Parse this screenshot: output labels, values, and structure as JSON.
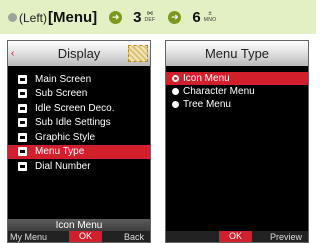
{
  "instruction": {
    "prefix": "(Left)",
    "menu": "[Menu]",
    "step1_number": "3",
    "step1_symbol": "⋈",
    "step1_letters": "DEF",
    "step2_number": "6",
    "step2_symbol": "±",
    "step2_letters": "MNO",
    "arrow_icon": "arrow-right-icon"
  },
  "left_screen": {
    "title": "Display",
    "items": [
      {
        "label": "Main Screen",
        "icon": "main-screen-icon"
      },
      {
        "label": "Sub Screen",
        "icon": "sub-screen-icon"
      },
      {
        "label": "Idle Screen Deco.",
        "icon": "idle-deco-icon"
      },
      {
        "label": "Sub Idle Settings",
        "icon": "sub-idle-icon"
      },
      {
        "label": "Graphic Style",
        "icon": "graphic-style-icon"
      },
      {
        "label": "Menu Type",
        "icon": "menu-type-icon"
      },
      {
        "label": "Dial Number",
        "icon": "dial-number-icon"
      }
    ],
    "selected_index": 5,
    "current_value": "Icon Menu",
    "softkeys": {
      "left": "My Menu",
      "center": "OK",
      "right": "Back"
    }
  },
  "right_screen": {
    "title": "Menu Type",
    "options": [
      "Icon Menu",
      "Character Menu",
      "Tree Menu"
    ],
    "selected_index": 0,
    "softkeys": {
      "center": "OK",
      "right": "Preview"
    }
  },
  "colors": {
    "instruction_bg": "#e3f0c4",
    "selection_red": "#d11f2c",
    "arrow_green": "#7a9a1e"
  }
}
